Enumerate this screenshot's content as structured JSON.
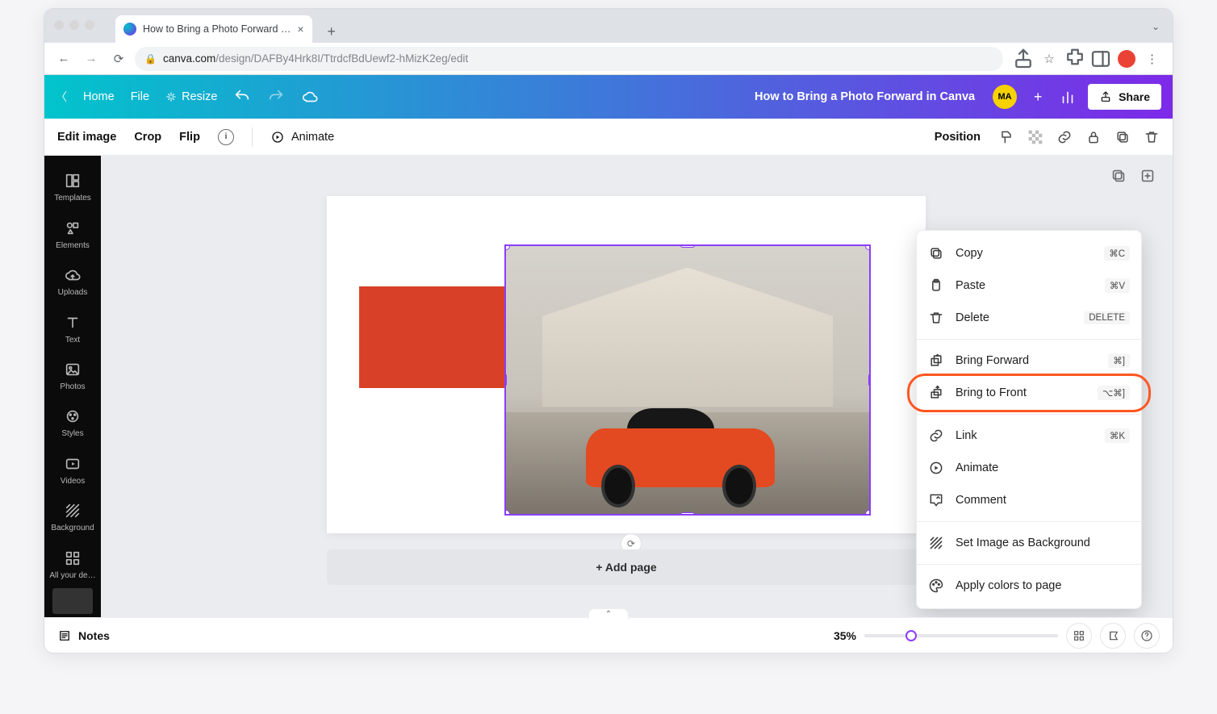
{
  "browser": {
    "tab_title": "How to Bring a Photo Forward …",
    "url_host": "canva.com",
    "url_path": "/design/DAFBy4Hrk8I/TtrdcfBdUewf2-hMizK2eg/edit"
  },
  "canva_header": {
    "home": "Home",
    "file": "File",
    "resize": "Resize",
    "doc_title": "How to Bring a Photo Forward in Canva",
    "avatar": "MA",
    "share": "Share"
  },
  "editor_bar": {
    "edit_image": "Edit image",
    "crop": "Crop",
    "flip": "Flip",
    "animate": "Animate",
    "position": "Position"
  },
  "sidebar": {
    "items": [
      {
        "label": "Templates"
      },
      {
        "label": "Elements"
      },
      {
        "label": "Uploads"
      },
      {
        "label": "Text"
      },
      {
        "label": "Photos"
      },
      {
        "label": "Styles"
      },
      {
        "label": "Videos"
      },
      {
        "label": "Background"
      },
      {
        "label": "All your de…"
      }
    ]
  },
  "canvas": {
    "add_page": "+ Add page"
  },
  "context_menu": {
    "copy": {
      "label": "Copy",
      "kbd": "⌘C"
    },
    "paste": {
      "label": "Paste",
      "kbd": "⌘V"
    },
    "delete": {
      "label": "Delete",
      "kbd": "DELETE"
    },
    "bring_forward": {
      "label": "Bring Forward",
      "kbd": "⌘]"
    },
    "bring_to_front": {
      "label": "Bring to Front",
      "kbd": "⌥⌘]"
    },
    "link": {
      "label": "Link",
      "kbd": "⌘K"
    },
    "animate": {
      "label": "Animate"
    },
    "comment": {
      "label": "Comment"
    },
    "set_bg": {
      "label": "Set Image as Background"
    },
    "apply_colors": {
      "label": "Apply colors to page"
    }
  },
  "bottom": {
    "notes": "Notes",
    "zoom": "35%"
  }
}
